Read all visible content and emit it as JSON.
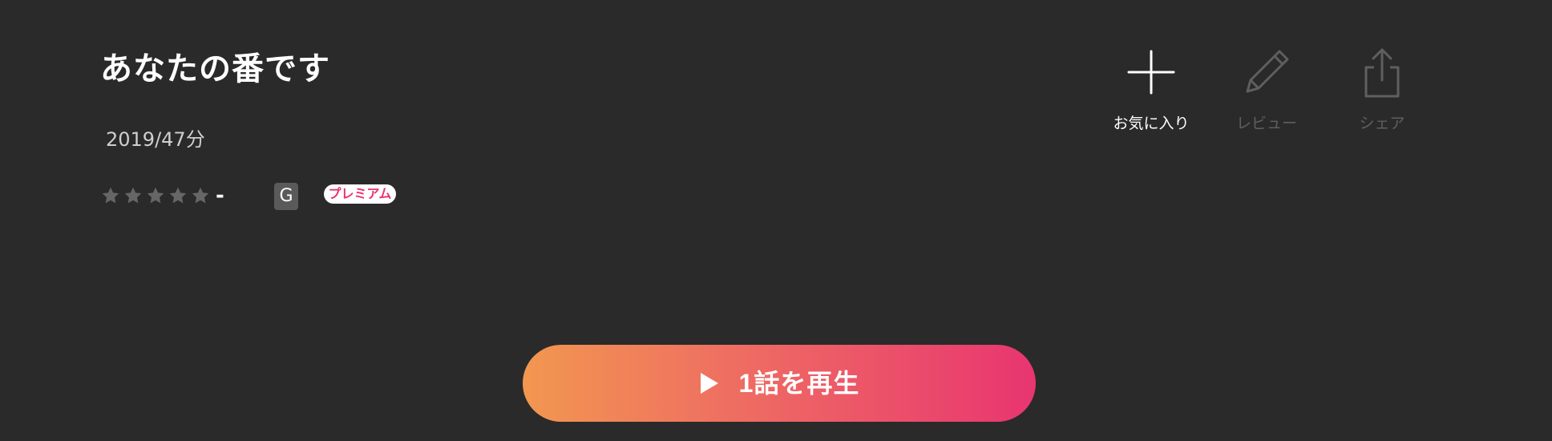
{
  "title": "あなたの番です",
  "meta": "2019/47分",
  "rating": {
    "stars_filled": 0,
    "stars_total": 5,
    "value": "-"
  },
  "age_rating": "G",
  "premium_label": "プレミアム",
  "actions": {
    "favorite": {
      "label": "お気に入り",
      "icon": "plus-icon",
      "enabled": true
    },
    "review": {
      "label": "レビュー",
      "icon": "pencil-icon",
      "enabled": false
    },
    "share": {
      "label": "シェア",
      "icon": "share-icon",
      "enabled": false
    }
  },
  "play_button": {
    "label": "1話を再生",
    "icon": "play-icon"
  },
  "colors": {
    "background": "#2a2a2a",
    "star_empty": "#666666",
    "disabled": "#5f5f5f",
    "gradient_start": "#f29750",
    "gradient_end": "#e83570",
    "premium_text": "#e8356f"
  }
}
